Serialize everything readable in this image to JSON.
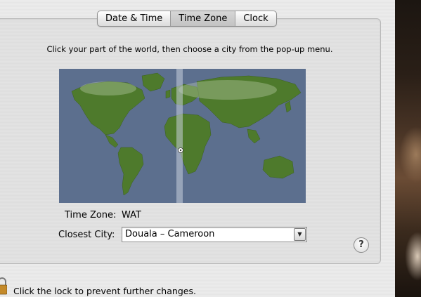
{
  "tabs": [
    {
      "label": "Date & Time",
      "active": false
    },
    {
      "label": "Time Zone",
      "active": true
    },
    {
      "label": "Clock",
      "active": false
    }
  ],
  "instruction": "Click your part of the world, then choose a city from the pop-up menu.",
  "time_zone": {
    "label": "Time Zone:",
    "value": "WAT"
  },
  "closest_city": {
    "label": "Closest City:",
    "value": "Douala – Cameroon",
    "dropdown_icon": "chevron-down-icon"
  },
  "help": {
    "glyph": "?"
  },
  "lock": {
    "text": "Click the lock to prevent further changes.",
    "icon": "padlock-icon"
  },
  "colors": {
    "ocean": "#5c6f8e",
    "land": "#4e7a2c",
    "highlight_band": "#c8d0dc"
  }
}
